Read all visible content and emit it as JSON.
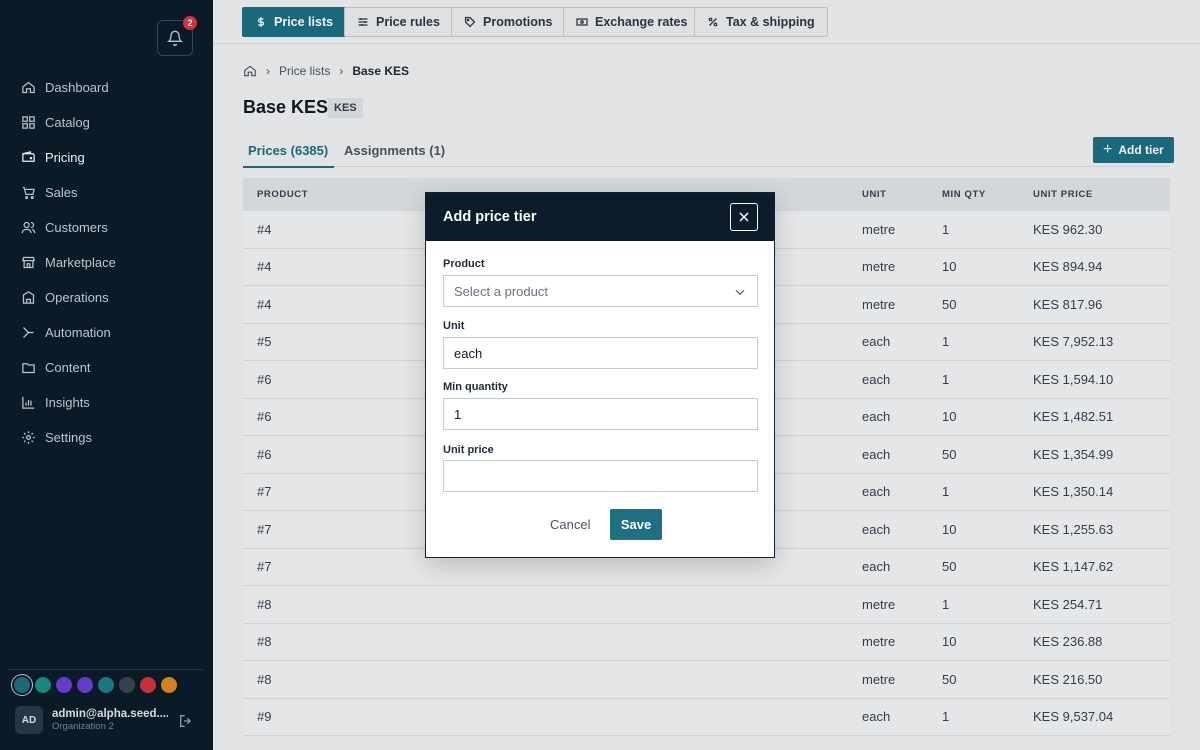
{
  "notifications": {
    "count": "2"
  },
  "sidebar": {
    "items": [
      {
        "label": "Dashboard",
        "icon": "home-icon"
      },
      {
        "label": "Catalog",
        "icon": "grid-icon"
      },
      {
        "label": "Pricing",
        "icon": "wallet-icon"
      },
      {
        "label": "Sales",
        "icon": "cart-icon"
      },
      {
        "label": "Customers",
        "icon": "users-icon"
      },
      {
        "label": "Marketplace",
        "icon": "store-icon"
      },
      {
        "label": "Operations",
        "icon": "building-icon"
      },
      {
        "label": "Automation",
        "icon": "workflow-icon"
      },
      {
        "label": "Content",
        "icon": "folder-icon"
      },
      {
        "label": "Insights",
        "icon": "chart-icon"
      },
      {
        "label": "Settings",
        "icon": "gear-icon"
      }
    ],
    "theme_colors": [
      "#1d6f82",
      "#1a8f8a",
      "#6d3fd6",
      "#6d3fd6",
      "#1d7f8a",
      "#3a4652",
      "#d3343f",
      "#e08a1e"
    ],
    "user": {
      "initials": "AD",
      "email": "admin@alpha.seed....",
      "org": "Organization 2"
    }
  },
  "topnav": {
    "tabs": [
      {
        "label": "Price lists",
        "icon": "dollar-icon"
      },
      {
        "label": "Price rules",
        "icon": "sliders-icon"
      },
      {
        "label": "Promotions",
        "icon": "tag-icon"
      },
      {
        "label": "Exchange rates",
        "icon": "banknote-icon"
      },
      {
        "label": "Tax & shipping",
        "icon": "percent-icon"
      }
    ]
  },
  "breadcrumb": {
    "parent": "Price lists",
    "current": "Base KES"
  },
  "page": {
    "title": "Base KES",
    "currency": "KES",
    "tabs": [
      "Prices (6385)",
      "Assignments (1)"
    ],
    "add_label": "Add tier"
  },
  "table": {
    "headers": [
      "PRODUCT",
      "UNIT",
      "MIN QTY",
      "UNIT PRICE"
    ],
    "rows": [
      [
        "#4",
        "metre",
        "1",
        "KES 962.30"
      ],
      [
        "#4",
        "metre",
        "10",
        "KES 894.94"
      ],
      [
        "#4",
        "metre",
        "50",
        "KES 817.96"
      ],
      [
        "#5",
        "each",
        "1",
        "KES 7,952.13"
      ],
      [
        "#6",
        "each",
        "1",
        "KES 1,594.10"
      ],
      [
        "#6",
        "each",
        "10",
        "KES 1,482.51"
      ],
      [
        "#6",
        "each",
        "50",
        "KES 1,354.99"
      ],
      [
        "#7",
        "each",
        "1",
        "KES 1,350.14"
      ],
      [
        "#7",
        "each",
        "10",
        "KES 1,255.63"
      ],
      [
        "#7",
        "each",
        "50",
        "KES 1,147.62"
      ],
      [
        "#8",
        "metre",
        "1",
        "KES 254.71"
      ],
      [
        "#8",
        "metre",
        "10",
        "KES 236.88"
      ],
      [
        "#8",
        "metre",
        "50",
        "KES 216.50"
      ],
      [
        "#9",
        "each",
        "1",
        "KES 9,537.04"
      ]
    ]
  },
  "modal": {
    "title": "Add price tier",
    "product_label": "Product",
    "product_placeholder": "Select a product",
    "unit_label": "Unit",
    "unit_value": "each",
    "min_qty_label": "Min quantity",
    "min_qty_value": "1",
    "unit_price_label": "Unit price",
    "unit_price_value": "",
    "cancel_label": "Cancel",
    "save_label": "Save"
  }
}
